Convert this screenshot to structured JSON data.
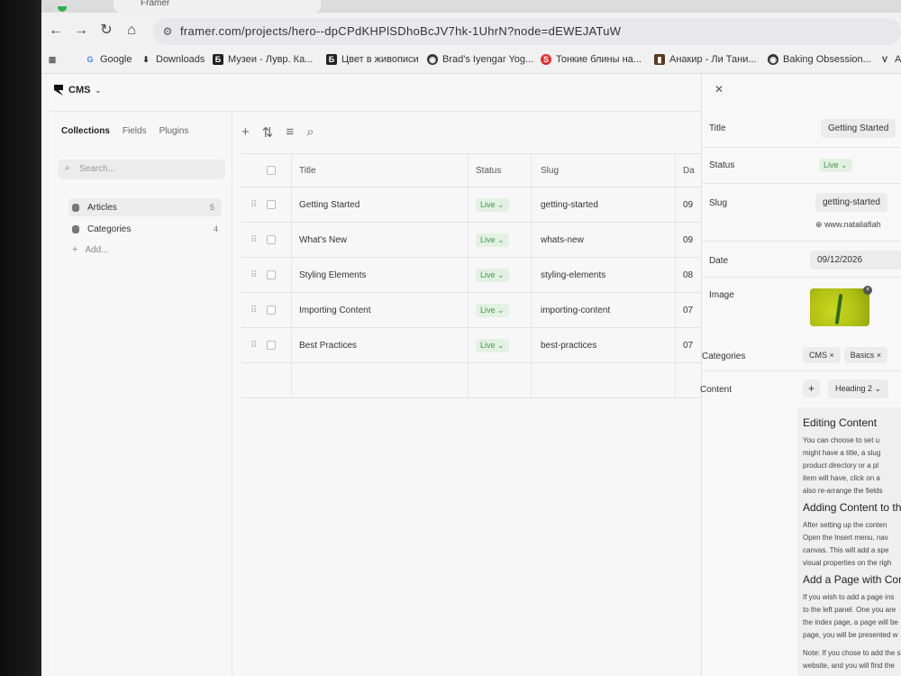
{
  "browser": {
    "tab_title": "Framer",
    "url": "framer.com/projects/hero--dpCPdKHPlSDhoBcJV7hk-1UhrN?node=dEWEJATuW",
    "bookmarks": [
      {
        "label": "Google",
        "icon": "google-icon"
      },
      {
        "label": "Downloads",
        "icon": "download-icon"
      },
      {
        "label": "Музеи - Лувр. Ка...",
        "icon": "b-letter-icon"
      },
      {
        "label": "Цвет в живописи",
        "icon": "b-letter-icon"
      },
      {
        "label": "Brad's Iyengar Yog...",
        "icon": "globe-icon"
      },
      {
        "label": "Тонкие блины на...",
        "icon": "s-letter-icon"
      },
      {
        "label": "Анакир - Ли Тани...",
        "icon": "book-icon"
      },
      {
        "label": "Baking Obsession...",
        "icon": "globe-icon"
      },
      {
        "label": "Al",
        "icon": "v-letter-icon"
      }
    ]
  },
  "app": {
    "menu_label": "CMS",
    "sidebar": {
      "tabs": [
        "Collections",
        "Fields",
        "Plugins"
      ],
      "search_placeholder": "Search...",
      "collections": [
        {
          "name": "Articles",
          "count": "5"
        },
        {
          "name": "Categories",
          "count": "4"
        }
      ],
      "add_label": "Add..."
    },
    "table": {
      "headers": {
        "title": "Title",
        "status": "Status",
        "slug": "Slug",
        "date": "Da"
      },
      "rows": [
        {
          "title": "Getting Started",
          "status": "Live",
          "slug": "getting-started",
          "date": "09"
        },
        {
          "title": "What's New",
          "status": "Live",
          "slug": "whats-new",
          "date": "09"
        },
        {
          "title": "Styling Elements",
          "status": "Live",
          "slug": "styling-elements",
          "date": "08"
        },
        {
          "title": "Importing Content",
          "status": "Live",
          "slug": "importing-content",
          "date": "07"
        },
        {
          "title": "Best Practices",
          "status": "Live",
          "slug": "best-practices",
          "date": "07"
        }
      ]
    },
    "panel": {
      "title_label": "Title",
      "title_value": "Getting Started",
      "status_label": "Status",
      "status_value": "Live",
      "slug_label": "Slug",
      "slug_value": "getting-started",
      "slug_url": "www.nataliafiah",
      "date_label": "Date",
      "date_value": "09/12/2026",
      "image_label": "Image",
      "categories_label": "Categories",
      "categories": [
        "CMS",
        "Basics"
      ],
      "content_label": "Content",
      "heading_select": "Heading 2",
      "content": {
        "h1": "Editing Content",
        "p1": [
          "You can choose to set u",
          "might have a title, a slug",
          "product directory or a pl",
          "item will have, click on a",
          "also re-arrange the fields"
        ],
        "h2": "Adding Content to th",
        "p2": [
          "After setting up the conten",
          "Open the Insert menu, nav",
          "canvas. This will add a spe",
          "visual properties on the righ"
        ],
        "h3": "Add a Page with Conte",
        "p3": [
          "If you wish to add a page ins",
          "to the left panel. One you are",
          "the index page, a page will be",
          "page, you will be presented w"
        ],
        "note": [
          "Note: If you chose to add the s",
          "website, and you will find the"
        ]
      }
    }
  },
  "colors": {
    "live_green": "#3f9a47",
    "live_bg": "#e3f1e3"
  }
}
